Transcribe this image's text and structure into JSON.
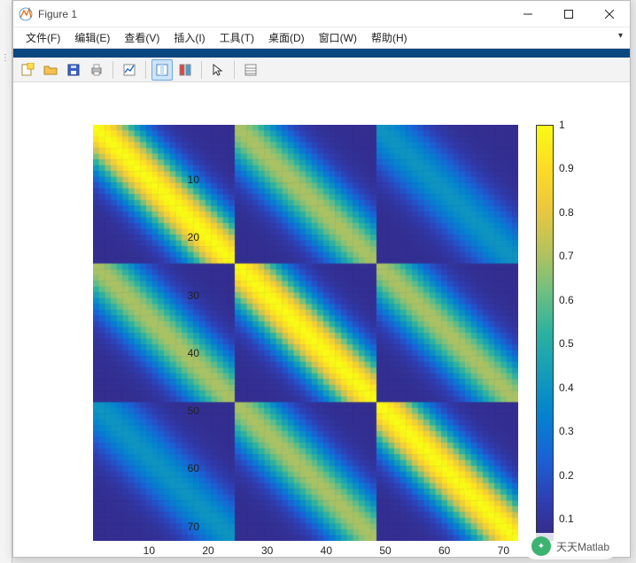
{
  "window": {
    "title": "Figure 1"
  },
  "menu": {
    "items": [
      "文件(F)",
      "编辑(E)",
      "查看(V)",
      "插入(I)",
      "工具(T)",
      "桌面(D)",
      "窗口(W)",
      "帮助(H)"
    ]
  },
  "watermark": "天天Matlab",
  "chart_data": {
    "type": "heatmap",
    "size": 72,
    "block_size": 24,
    "block_max": [
      [
        1.0,
        0.7,
        0.4
      ],
      [
        0.7,
        1.0,
        0.7
      ],
      [
        0.4,
        0.7,
        1.0
      ]
    ],
    "x_ticks": [
      10,
      20,
      30,
      40,
      50,
      60,
      70
    ],
    "y_ticks": [
      10,
      20,
      30,
      40,
      50,
      60,
      70
    ],
    "xlim": [
      0.5,
      72.5
    ],
    "ylim": [
      0.5,
      72.5
    ],
    "colorbar": {
      "ticks": [
        0.1,
        0.2,
        0.3,
        0.4,
        0.5,
        0.6,
        0.7,
        0.8,
        0.9,
        1
      ],
      "min": 0.05,
      "max": 1.0,
      "colormap": "parula"
    },
    "colormap_stops": [
      [
        0.0,
        [
          53,
          42,
          135
        ]
      ],
      [
        0.1,
        [
          47,
          64,
          181
        ]
      ],
      [
        0.2,
        [
          27,
          99,
          214
        ]
      ],
      [
        0.3,
        [
          4,
          131,
          207
        ]
      ],
      [
        0.4,
        [
          20,
          156,
          186
        ]
      ],
      [
        0.5,
        [
          45,
          178,
          161
        ]
      ],
      [
        0.6,
        [
          112,
          192,
          128
        ]
      ],
      [
        0.7,
        [
          184,
          195,
          93
        ]
      ],
      [
        0.8,
        [
          235,
          201,
          63
        ]
      ],
      [
        0.9,
        [
          253,
          220,
          38
        ]
      ],
      [
        1.0,
        [
          249,
          251,
          21
        ]
      ]
    ]
  }
}
